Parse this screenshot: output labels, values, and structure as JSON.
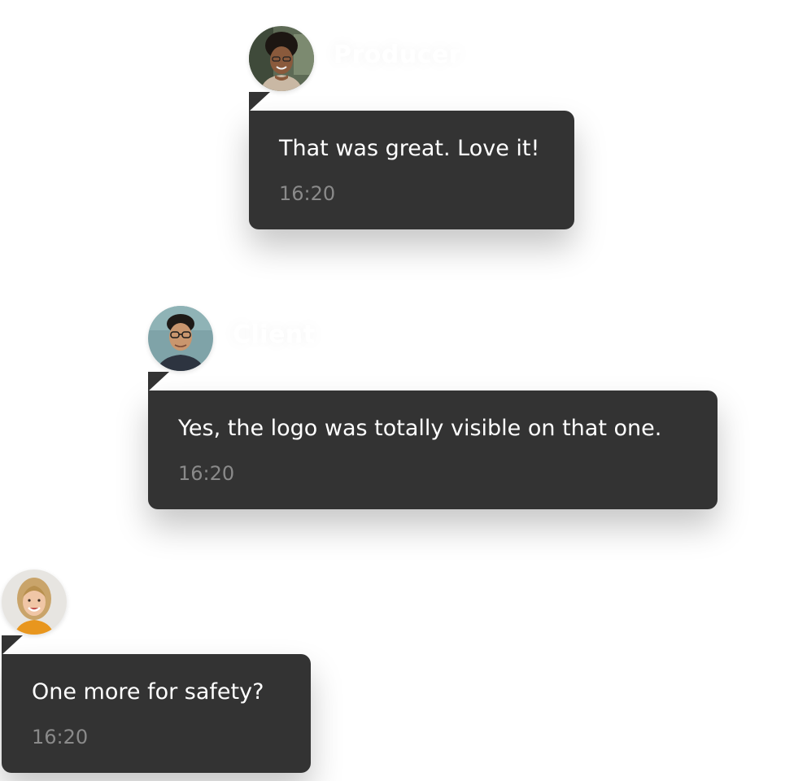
{
  "messages": [
    {
      "sender": "Producer",
      "text": "That was great. Love it!",
      "time": "16:20",
      "avatar_icon": "producer-avatar"
    },
    {
      "sender": "Client",
      "text": "Yes, the logo was totally visible on that one.",
      "time": "16:20",
      "avatar_icon": "client-avatar"
    },
    {
      "sender": "",
      "text": "One more for safety?",
      "time": "16:20",
      "avatar_icon": "third-participant-avatar"
    }
  ],
  "colors": {
    "bubble": "#333333",
    "text": "#ffffff",
    "time": "#8a8a8a",
    "background": "#ffffff"
  }
}
